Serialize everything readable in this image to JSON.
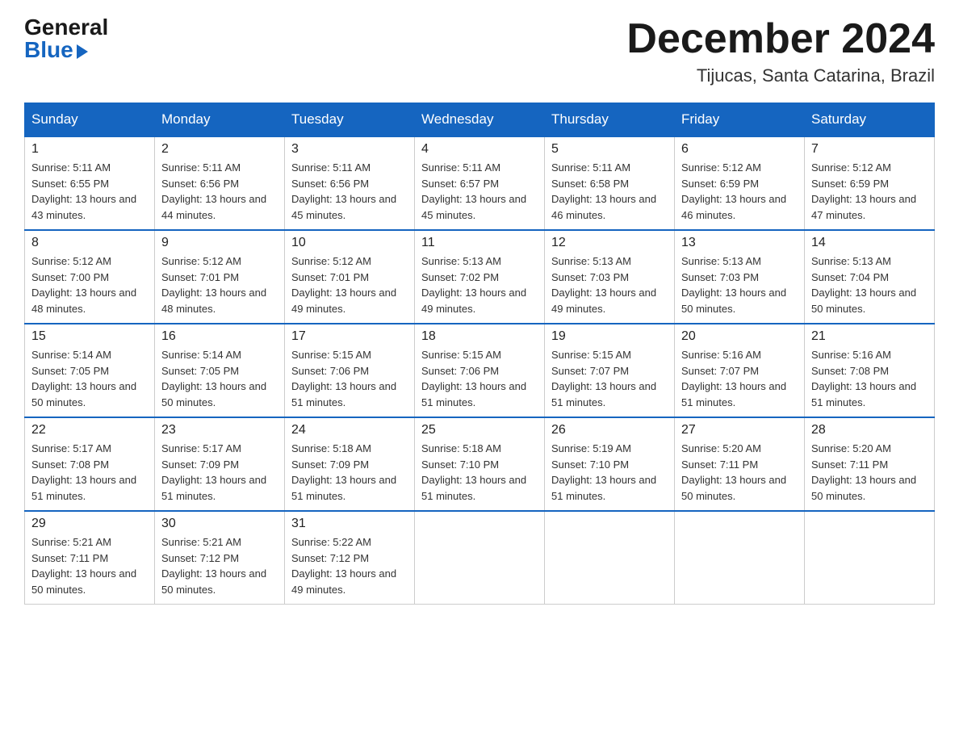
{
  "header": {
    "logo_general": "General",
    "logo_blue": "Blue",
    "month_title": "December 2024",
    "location": "Tijucas, Santa Catarina, Brazil"
  },
  "weekdays": [
    "Sunday",
    "Monday",
    "Tuesday",
    "Wednesday",
    "Thursday",
    "Friday",
    "Saturday"
  ],
  "weeks": [
    [
      {
        "day": "1",
        "sunrise": "5:11 AM",
        "sunset": "6:55 PM",
        "daylight": "13 hours and 43 minutes."
      },
      {
        "day": "2",
        "sunrise": "5:11 AM",
        "sunset": "6:56 PM",
        "daylight": "13 hours and 44 minutes."
      },
      {
        "day": "3",
        "sunrise": "5:11 AM",
        "sunset": "6:56 PM",
        "daylight": "13 hours and 45 minutes."
      },
      {
        "day": "4",
        "sunrise": "5:11 AM",
        "sunset": "6:57 PM",
        "daylight": "13 hours and 45 minutes."
      },
      {
        "day": "5",
        "sunrise": "5:11 AM",
        "sunset": "6:58 PM",
        "daylight": "13 hours and 46 minutes."
      },
      {
        "day": "6",
        "sunrise": "5:12 AM",
        "sunset": "6:59 PM",
        "daylight": "13 hours and 46 minutes."
      },
      {
        "day": "7",
        "sunrise": "5:12 AM",
        "sunset": "6:59 PM",
        "daylight": "13 hours and 47 minutes."
      }
    ],
    [
      {
        "day": "8",
        "sunrise": "5:12 AM",
        "sunset": "7:00 PM",
        "daylight": "13 hours and 48 minutes."
      },
      {
        "day": "9",
        "sunrise": "5:12 AM",
        "sunset": "7:01 PM",
        "daylight": "13 hours and 48 minutes."
      },
      {
        "day": "10",
        "sunrise": "5:12 AM",
        "sunset": "7:01 PM",
        "daylight": "13 hours and 49 minutes."
      },
      {
        "day": "11",
        "sunrise": "5:13 AM",
        "sunset": "7:02 PM",
        "daylight": "13 hours and 49 minutes."
      },
      {
        "day": "12",
        "sunrise": "5:13 AM",
        "sunset": "7:03 PM",
        "daylight": "13 hours and 49 minutes."
      },
      {
        "day": "13",
        "sunrise": "5:13 AM",
        "sunset": "7:03 PM",
        "daylight": "13 hours and 50 minutes."
      },
      {
        "day": "14",
        "sunrise": "5:13 AM",
        "sunset": "7:04 PM",
        "daylight": "13 hours and 50 minutes."
      }
    ],
    [
      {
        "day": "15",
        "sunrise": "5:14 AM",
        "sunset": "7:05 PM",
        "daylight": "13 hours and 50 minutes."
      },
      {
        "day": "16",
        "sunrise": "5:14 AM",
        "sunset": "7:05 PM",
        "daylight": "13 hours and 50 minutes."
      },
      {
        "day": "17",
        "sunrise": "5:15 AM",
        "sunset": "7:06 PM",
        "daylight": "13 hours and 51 minutes."
      },
      {
        "day": "18",
        "sunrise": "5:15 AM",
        "sunset": "7:06 PM",
        "daylight": "13 hours and 51 minutes."
      },
      {
        "day": "19",
        "sunrise": "5:15 AM",
        "sunset": "7:07 PM",
        "daylight": "13 hours and 51 minutes."
      },
      {
        "day": "20",
        "sunrise": "5:16 AM",
        "sunset": "7:07 PM",
        "daylight": "13 hours and 51 minutes."
      },
      {
        "day": "21",
        "sunrise": "5:16 AM",
        "sunset": "7:08 PM",
        "daylight": "13 hours and 51 minutes."
      }
    ],
    [
      {
        "day": "22",
        "sunrise": "5:17 AM",
        "sunset": "7:08 PM",
        "daylight": "13 hours and 51 minutes."
      },
      {
        "day": "23",
        "sunrise": "5:17 AM",
        "sunset": "7:09 PM",
        "daylight": "13 hours and 51 minutes."
      },
      {
        "day": "24",
        "sunrise": "5:18 AM",
        "sunset": "7:09 PM",
        "daylight": "13 hours and 51 minutes."
      },
      {
        "day": "25",
        "sunrise": "5:18 AM",
        "sunset": "7:10 PM",
        "daylight": "13 hours and 51 minutes."
      },
      {
        "day": "26",
        "sunrise": "5:19 AM",
        "sunset": "7:10 PM",
        "daylight": "13 hours and 51 minutes."
      },
      {
        "day": "27",
        "sunrise": "5:20 AM",
        "sunset": "7:11 PM",
        "daylight": "13 hours and 50 minutes."
      },
      {
        "day": "28",
        "sunrise": "5:20 AM",
        "sunset": "7:11 PM",
        "daylight": "13 hours and 50 minutes."
      }
    ],
    [
      {
        "day": "29",
        "sunrise": "5:21 AM",
        "sunset": "7:11 PM",
        "daylight": "13 hours and 50 minutes."
      },
      {
        "day": "30",
        "sunrise": "5:21 AM",
        "sunset": "7:12 PM",
        "daylight": "13 hours and 50 minutes."
      },
      {
        "day": "31",
        "sunrise": "5:22 AM",
        "sunset": "7:12 PM",
        "daylight": "13 hours and 49 minutes."
      },
      null,
      null,
      null,
      null
    ]
  ]
}
